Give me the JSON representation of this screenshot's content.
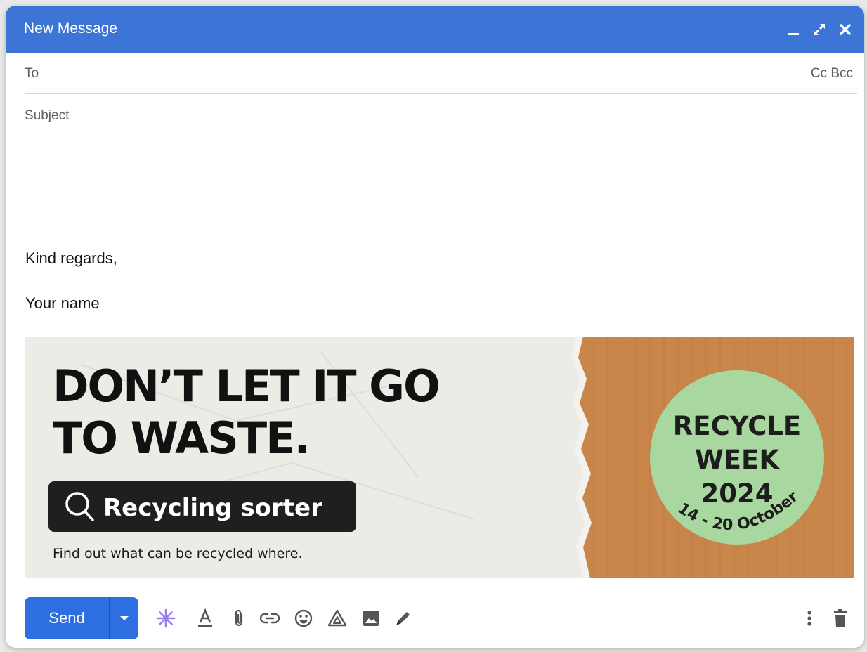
{
  "window": {
    "title": "New Message",
    "controls": [
      "minimize-icon",
      "expand-icon",
      "close-icon"
    ]
  },
  "fields": {
    "to_label": "To",
    "cc_bcc": "Cc Bcc",
    "subject_placeholder": "Subject"
  },
  "body": {
    "line1": "Kind regards,",
    "line2": "Your name"
  },
  "banner": {
    "headline_line1": "DON’T LET IT GO",
    "headline_line2": "TO WASTE.",
    "button_text": "Recycling sorter",
    "tagline": "Find out what can be recycled where.",
    "badge_line1": "RECYCLE",
    "badge_line2": "WEEK",
    "badge_line3": "2024",
    "badge_dates": "14 - 20 October",
    "colors": {
      "paper": "#ecebe6",
      "cardboard": "#c9864b",
      "badge": "#a8d8a0",
      "dark": "#1a1a1a"
    }
  },
  "toolbar": {
    "send_label": "Send",
    "icons": [
      "send-options-icon",
      "sparkle-icon",
      "text-format-icon",
      "attachment-icon",
      "link-icon",
      "emoji-icon",
      "drive-icon",
      "photo-icon",
      "signature-icon",
      "more-options-icon",
      "trash-icon"
    ]
  },
  "colors": {
    "header": "#3d75d7",
    "send": "#2d6fe0",
    "sparkle": "#9b7cf0"
  }
}
